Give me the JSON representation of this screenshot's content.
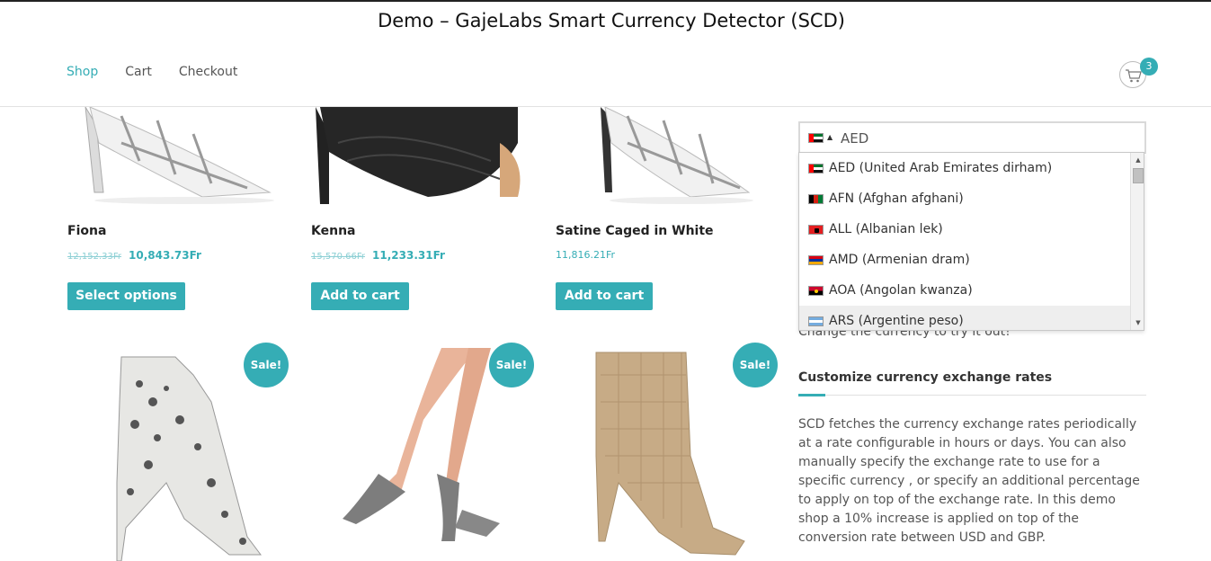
{
  "site": {
    "title": "Demo – GajeLabs Smart Currency Detector (SCD)"
  },
  "nav": {
    "items": [
      "Shop",
      "Cart",
      "Checkout"
    ]
  },
  "cart": {
    "count": "3",
    "icon": "cart-icon"
  },
  "products": [
    {
      "name": "Fiona",
      "old_price": "12,152.33Fr",
      "price": "10,843.73Fr",
      "button": "Select options"
    },
    {
      "name": "Kenna",
      "old_price": "15,570.66Fr",
      "price": "11,233.31Fr",
      "button": "Add to cart"
    },
    {
      "name": "Satine Caged in White",
      "price": "11,816.21Fr",
      "button": "Add to cart"
    }
  ],
  "sale_badge": "Sale!",
  "sidebar": {
    "currency_selected": "AED",
    "currency_options": [
      "AED (United Arab Emirates dirham)",
      "AFN (Afghan afghani)",
      "ALL (Albanian lek)",
      "AMD (Armenian dram)",
      "AOA (Angolan kwanza)",
      "ARS (Argentine peso)"
    ],
    "note": "Change the currency to try it out!",
    "heading": "Customize currency exchange rates",
    "paragraph": "SCD fetches the currency exchange rates periodically at a rate configurable in hours or days. You can also manually specify the exchange rate to use for a specific currency , or specify an additional percentage to apply on top of the exchange rate. In this demo shop a 10% increase is applied on top of the conversion rate between USD and GBP."
  },
  "colors": {
    "accent": "#35adb5"
  }
}
